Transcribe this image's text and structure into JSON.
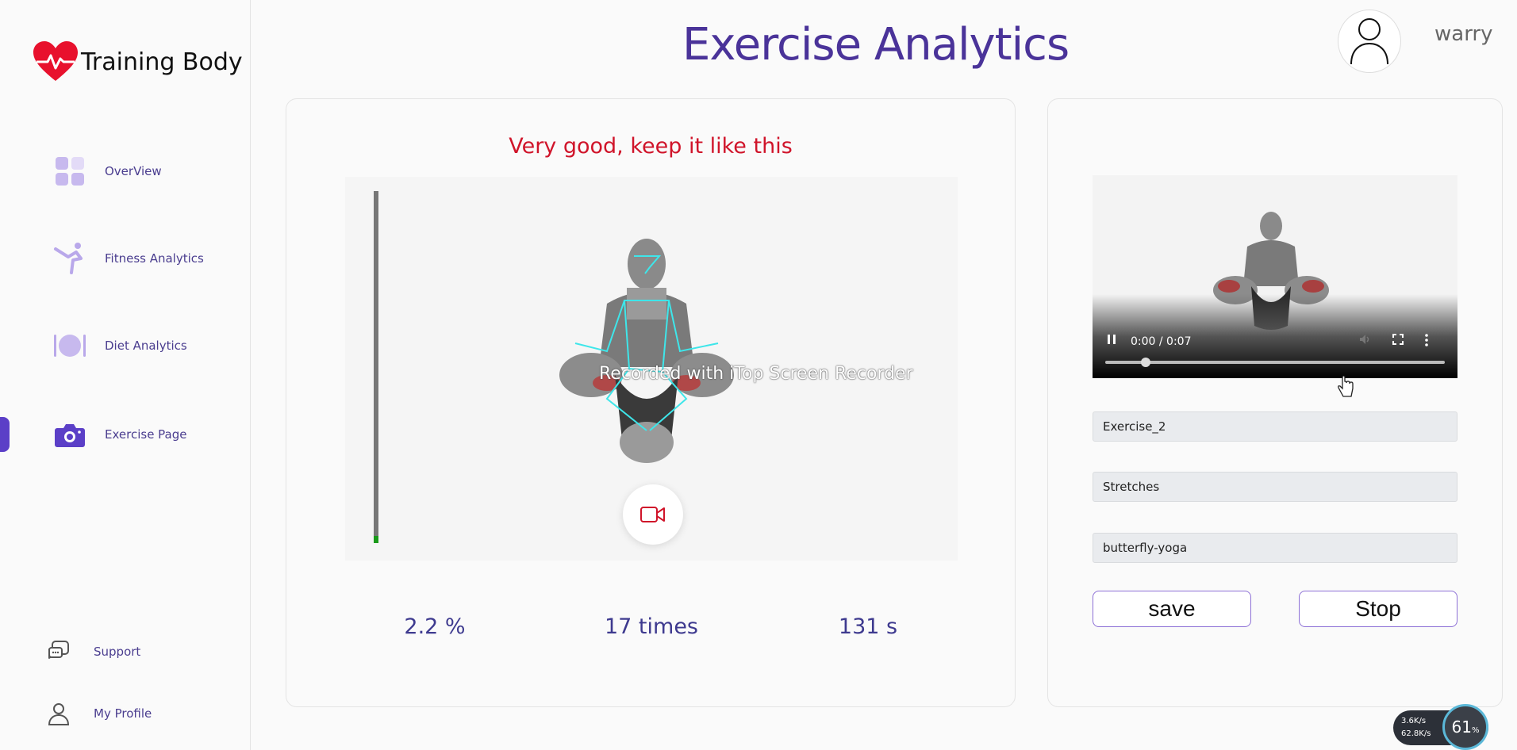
{
  "brand": {
    "name": "Training Body",
    "accent": "#e8112d"
  },
  "sidebar": {
    "items": [
      {
        "label": "OverView",
        "icon": "grid-icon"
      },
      {
        "label": "Fitness Analytics",
        "icon": "yoga-pose-icon"
      },
      {
        "label": "Diet Analytics",
        "icon": "plate-cutlery-icon"
      },
      {
        "label": "Exercise Page",
        "icon": "camera-icon",
        "active": true
      }
    ],
    "bottom": [
      {
        "label": "Support",
        "icon": "chat-icon"
      },
      {
        "label": "My Profile",
        "icon": "user-icon"
      }
    ]
  },
  "header": {
    "title": "Exercise Analytics",
    "username": "warry"
  },
  "exercise": {
    "feedback": "Very good, keep it like this",
    "watermark": "Recorded with iTop Screen Recorder",
    "progress": 0.02,
    "stats": {
      "accuracy": "2.2 %",
      "count": "17 times",
      "duration": "131 s"
    }
  },
  "video": {
    "time": "0:00 / 0:07",
    "progress": 0.12
  },
  "form": {
    "exercise_name": "Exercise_2",
    "category": "Stretches",
    "pose": "butterfly-yoga",
    "save_label": "save",
    "stop_label": "Stop"
  },
  "net": {
    "up": "3.6K/s",
    "down": "62.8K/s",
    "cpu": "61"
  },
  "colors": {
    "primary": "#4a3399",
    "feedback": "#d0142a",
    "border": "#8d70d6"
  }
}
